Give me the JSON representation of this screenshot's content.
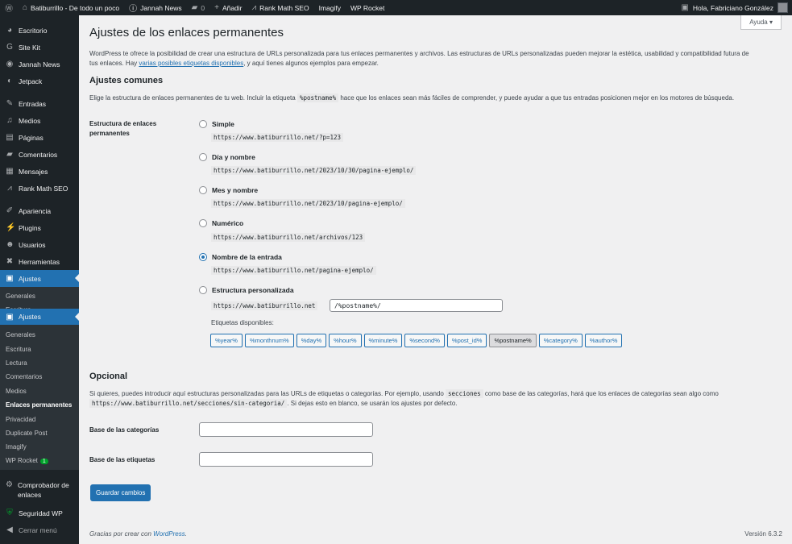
{
  "topbar": {
    "site": "Batiburrillo - De todo un poco",
    "jannah": "Jannah News",
    "comments": "0",
    "add": "Añadir",
    "rankmath": "Rank Math SEO",
    "imagify": "Imagify",
    "wprocket": "WP Rocket",
    "greeting": "Hola, Fabriciano González"
  },
  "sidebar": {
    "items": [
      {
        "label": "Escritorio",
        "icon": "dashboard-icon"
      },
      {
        "label": "Site Kit",
        "icon": "google-icon"
      },
      {
        "label": "Jannah News",
        "icon": "jannah-icon"
      },
      {
        "label": "Jetpack",
        "icon": "jetpack-icon"
      },
      {
        "label": "Entradas",
        "icon": "pin-icon"
      },
      {
        "label": "Medios",
        "icon": "media-icon"
      },
      {
        "label": "Páginas",
        "icon": "pages-icon"
      },
      {
        "label": "Comentarios",
        "icon": "comment-icon"
      },
      {
        "label": "Mensajes",
        "icon": "messages-icon"
      },
      {
        "label": "Rank Math SEO",
        "icon": "rankmath-icon"
      },
      {
        "label": "Apariencia",
        "icon": "brush-icon"
      },
      {
        "label": "Plugins",
        "icon": "plugin-icon"
      },
      {
        "label": "Usuarios",
        "icon": "users-icon"
      },
      {
        "label": "Herramientas",
        "icon": "tools-icon"
      },
      {
        "label": "Ajustes",
        "icon": "settings-icon"
      }
    ],
    "ghost": {
      "generales": "Generales",
      "escritura": "Escritura",
      "ajustes": "Ajustes"
    },
    "submenu": [
      "Generales",
      "Escritura",
      "Lectura",
      "Comentarios",
      "Medios",
      "Enlaces permanentes",
      "Privacidad",
      "Duplicate Post",
      "Imagify",
      "WP Rocket"
    ],
    "wprocket_badge": "1",
    "bottom": [
      {
        "label": "Comprobador de enlaces",
        "icon": "link-checker-icon"
      },
      {
        "label": "Seguridad WP",
        "icon": "shield-icon"
      },
      {
        "label": "Cerrar menú",
        "icon": "collapse-icon"
      }
    ]
  },
  "help": "Ayuda ▾",
  "page": {
    "title": "Ajustes de los enlaces permanentes",
    "intro_1": "WordPress te ofrece la posibilidad de crear una estructura de URLs personalizada para tus enlaces permanentes y archivos. Las estructuras de URLs personalizadas pueden mejorar la estética, usabilidad y compatibilidad futura de",
    "intro_2a": "tus enlaces. Hay ",
    "intro_link": "varias posibles etiquetas disponibles",
    "intro_2b": ", y aquí tienes algunos ejemplos para empezar.",
    "common_title": "Ajustes comunes",
    "common_desc_a": "Elige la estructura de enlaces permanentes de tu web. Incluir la etiqueta ",
    "common_code": "%postname%",
    "common_desc_b": " hace que los enlaces sean más fáciles de comprender, y puede ayudar a que tus entradas posicionen mejor en los motores de búsqueda.",
    "structure_label": "Estructura de enlaces permanentes",
    "options": [
      {
        "label": "Simple",
        "example": "https://www.batiburrillo.net/?p=123",
        "checked": false
      },
      {
        "label": "Día y nombre",
        "example": "https://www.batiburrillo.net/2023/10/30/pagina-ejemplo/",
        "checked": false
      },
      {
        "label": "Mes y nombre",
        "example": "https://www.batiburrillo.net/2023/10/pagina-ejemplo/",
        "checked": false
      },
      {
        "label": "Numérico",
        "example": "https://www.batiburrillo.net/archivos/123",
        "checked": false
      },
      {
        "label": "Nombre de la entrada",
        "example": "https://www.batiburrillo.net/pagina-ejemplo/",
        "checked": true
      },
      {
        "label": "Estructura personalizada",
        "example": "https://www.batiburrillo.net",
        "checked": false
      }
    ],
    "custom_value": "/%postname%/",
    "tags_label": "Etiquetas disponibles:",
    "tags": [
      "%year%",
      "%monthnum%",
      "%day%",
      "%hour%",
      "%minute%",
      "%second%",
      "%post_id%",
      "%postname%",
      "%category%",
      "%author%"
    ],
    "selected_tag": "%postname%",
    "optional_title": "Opcional",
    "optional_a": "Si quieres, puedes introducir aquí estructuras personalizadas para las URLs de etiquetas o categorías. Por ejemplo, usando ",
    "optional_code1": "secciones",
    "optional_b": " como base de las categorías, hará que los enlaces de categorías sean algo como",
    "optional_code2": "https://www.batiburrillo.net/secciones/sin-categoria/",
    "optional_c": ". Si dejas esto en blanco, se usarán los ajustes por defecto.",
    "category_base_label": "Base de las categorías",
    "tag_base_label": "Base de las etiquetas",
    "category_base_value": "",
    "tag_base_value": "",
    "save": "Guardar cambios"
  },
  "footer": {
    "credit_a": "Gracias por crear con ",
    "credit_link": "WordPress",
    "credit_b": ".",
    "version": "Versión 6.3.2"
  },
  "colors": {
    "admin_bar": "#1d2327",
    "accent": "#2271b1",
    "background": "#f0f0f1"
  }
}
